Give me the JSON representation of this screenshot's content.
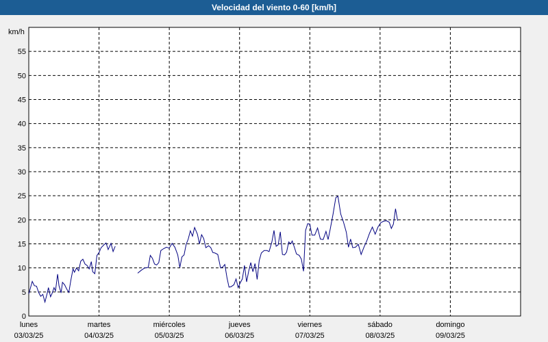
{
  "chart_data": {
    "type": "line",
    "title": "Velocidad del viento 0-60 [km/h]",
    "ylabel": "km/h",
    "xlabel": "",
    "ylim": [
      0,
      60
    ],
    "yticks": [
      0,
      5,
      10,
      15,
      20,
      25,
      30,
      35,
      40,
      45,
      50,
      55
    ],
    "xlim": [
      0,
      7
    ],
    "grid": true,
    "days": [
      {
        "name": "lunes",
        "date": "03/03/25"
      },
      {
        "name": "martes",
        "date": "04/03/25"
      },
      {
        "name": "miércoles",
        "date": "05/03/25"
      },
      {
        "name": "jueves",
        "date": "06/03/25"
      },
      {
        "name": "viernes",
        "date": "07/03/25"
      },
      {
        "name": "sábado",
        "date": "08/03/25"
      },
      {
        "name": "domingo",
        "date": "09/03/25"
      }
    ],
    "series": [
      {
        "color": "#000080",
        "segments": [
          [
            [
              0.0,
              4.6
            ],
            [
              0.05,
              7.2
            ],
            [
              0.08,
              6.3
            ],
            [
              0.11,
              6.2
            ],
            [
              0.14,
              4.9
            ],
            [
              0.17,
              4.1
            ],
            [
              0.2,
              4.5
            ],
            [
              0.23,
              2.9
            ],
            [
              0.26,
              4.6
            ],
            [
              0.28,
              5.9
            ],
            [
              0.31,
              4.0
            ],
            [
              0.33,
              4.6
            ],
            [
              0.36,
              5.9
            ],
            [
              0.38,
              5.2
            ],
            [
              0.41,
              8.7
            ],
            [
              0.43,
              6.3
            ],
            [
              0.46,
              4.8
            ],
            [
              0.48,
              7.0
            ],
            [
              0.51,
              6.5
            ],
            [
              0.54,
              5.6
            ],
            [
              0.57,
              4.9
            ],
            [
              0.6,
              7.5
            ],
            [
              0.63,
              9.8
            ],
            [
              0.65,
              9.1
            ],
            [
              0.68,
              10.0
            ],
            [
              0.71,
              9.4
            ],
            [
              0.74,
              11.4
            ],
            [
              0.77,
              11.8
            ],
            [
              0.8,
              10.8
            ],
            [
              0.83,
              10.5
            ],
            [
              0.86,
              9.8
            ],
            [
              0.89,
              11.3
            ],
            [
              0.91,
              9.2
            ],
            [
              0.94,
              8.8
            ],
            [
              0.97,
              12.6
            ],
            [
              1.0,
              13.2
            ],
            [
              1.03,
              14.2
            ],
            [
              1.07,
              14.8
            ],
            [
              1.1,
              15.2
            ],
            [
              1.13,
              13.8
            ],
            [
              1.17,
              15.1
            ],
            [
              1.2,
              13.4
            ],
            [
              1.23,
              14.5
            ]
          ],
          [
            [
              1.55,
              8.9
            ],
            [
              1.6,
              9.5
            ],
            [
              1.65,
              10.0
            ],
            [
              1.7,
              10.1
            ],
            [
              1.73,
              12.6
            ],
            [
              1.76,
              12.0
            ],
            [
              1.79,
              10.8
            ],
            [
              1.82,
              10.6
            ],
            [
              1.85,
              11.1
            ],
            [
              1.88,
              13.6
            ],
            [
              1.92,
              14.0
            ],
            [
              1.96,
              14.3
            ],
            [
              2.0,
              14.1
            ],
            [
              2.04,
              15.1
            ],
            [
              2.08,
              14.3
            ],
            [
              2.12,
              12.7
            ],
            [
              2.15,
              10.1
            ],
            [
              2.18,
              12.3
            ],
            [
              2.21,
              12.7
            ],
            [
              2.24,
              14.9
            ],
            [
              2.27,
              16.0
            ],
            [
              2.3,
              17.7
            ],
            [
              2.33,
              16.6
            ],
            [
              2.36,
              18.4
            ],
            [
              2.4,
              17.0
            ],
            [
              2.43,
              15.0
            ],
            [
              2.46,
              16.9
            ],
            [
              2.49,
              16.1
            ],
            [
              2.52,
              14.2
            ],
            [
              2.56,
              14.6
            ],
            [
              2.59,
              14.2
            ],
            [
              2.62,
              13.2
            ],
            [
              2.65,
              13.1
            ],
            [
              2.69,
              12.8
            ],
            [
              2.73,
              10.0
            ],
            [
              2.76,
              10.2
            ],
            [
              2.79,
              10.7
            ],
            [
              2.82,
              8.0
            ],
            [
              2.85,
              6.0
            ],
            [
              2.88,
              6.1
            ],
            [
              2.92,
              6.5
            ],
            [
              2.95,
              7.7
            ],
            [
              2.98,
              5.9
            ],
            [
              3.01,
              6.9
            ],
            [
              3.04,
              7.7
            ],
            [
              3.07,
              10.5
            ],
            [
              3.1,
              7.1
            ],
            [
              3.13,
              9.3
            ],
            [
              3.16,
              11.1
            ],
            [
              3.19,
              9.2
            ],
            [
              3.22,
              10.9
            ],
            [
              3.25,
              7.6
            ],
            [
              3.28,
              11.5
            ],
            [
              3.31,
              13.1
            ],
            [
              3.35,
              13.6
            ],
            [
              3.39,
              13.6
            ],
            [
              3.42,
              13.4
            ],
            [
              3.46,
              15.4
            ],
            [
              3.49,
              17.8
            ],
            [
              3.52,
              14.5
            ],
            [
              3.55,
              14.8
            ],
            [
              3.58,
              17.5
            ],
            [
              3.61,
              12.8
            ],
            [
              3.64,
              12.7
            ],
            [
              3.67,
              13.3
            ],
            [
              3.7,
              15.4
            ],
            [
              3.73,
              15.0
            ],
            [
              3.75,
              15.6
            ],
            [
              3.78,
              14.3
            ],
            [
              3.81,
              12.9
            ],
            [
              3.85,
              12.6
            ],
            [
              3.88,
              11.8
            ],
            [
              3.91,
              9.3
            ],
            [
              3.94,
              17.8
            ],
            [
              3.97,
              19.2
            ],
            [
              4.0,
              19.1
            ],
            [
              4.03,
              16.8
            ],
            [
              4.07,
              16.8
            ],
            [
              4.11,
              18.3
            ],
            [
              4.15,
              16.0
            ],
            [
              4.19,
              15.9
            ],
            [
              4.23,
              17.6
            ],
            [
              4.26,
              15.9
            ],
            [
              4.29,
              18.0
            ],
            [
              4.33,
              21.1
            ],
            [
              4.37,
              24.6
            ],
            [
              4.4,
              24.9
            ],
            [
              4.44,
              21.2
            ],
            [
              4.48,
              19.5
            ],
            [
              4.52,
              17.4
            ],
            [
              4.55,
              14.3
            ],
            [
              4.58,
              16.0
            ],
            [
              4.61,
              14.2
            ],
            [
              4.65,
              14.3
            ],
            [
              4.69,
              14.9
            ],
            [
              4.73,
              12.8
            ],
            [
              4.77,
              14.3
            ],
            [
              4.81,
              15.6
            ],
            [
              4.85,
              17.2
            ],
            [
              4.89,
              18.5
            ],
            [
              4.93,
              17.0
            ],
            [
              4.97,
              18.5
            ],
            [
              5.01,
              19.4
            ],
            [
              5.05,
              19.7
            ],
            [
              5.09,
              19.8
            ],
            [
              5.13,
              19.5
            ],
            [
              5.16,
              18.2
            ],
            [
              5.19,
              19.1
            ],
            [
              5.22,
              22.3
            ],
            [
              5.25,
              19.8
            ]
          ]
        ]
      }
    ]
  }
}
